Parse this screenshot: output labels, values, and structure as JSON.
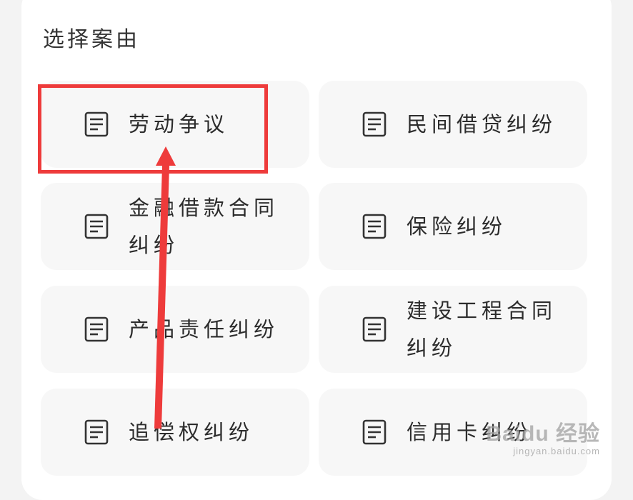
{
  "section": {
    "title": "选择案由"
  },
  "cases": [
    {
      "label": "劳动争议",
      "icon": "document-icon"
    },
    {
      "label": "民间借贷纠纷",
      "icon": "document-icon"
    },
    {
      "label": "金融借款合同纠纷",
      "icon": "document-icon"
    },
    {
      "label": "保险纠纷",
      "icon": "document-icon"
    },
    {
      "label": "产品责任纠纷",
      "icon": "document-icon"
    },
    {
      "label": "建设工程合同纠纷",
      "icon": "document-icon"
    },
    {
      "label": "追偿权纠纷",
      "icon": "document-icon"
    },
    {
      "label": "信用卡纠纷",
      "icon": "document-icon"
    }
  ],
  "annotation": {
    "color": "#ee3b3b",
    "highlighted_case": "劳动争议"
  },
  "watermark": {
    "main": "Baidu 经验",
    "sub": "jingyan.baidu.com"
  }
}
